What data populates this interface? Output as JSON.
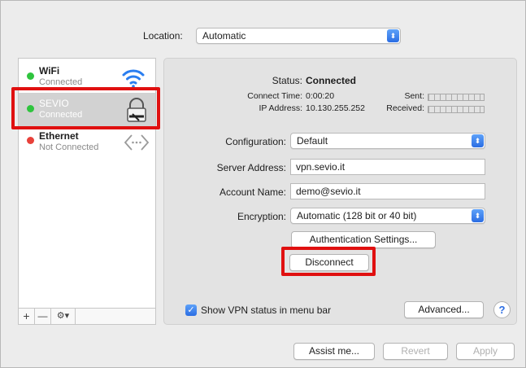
{
  "location": {
    "label": "Location:",
    "value": "Automatic"
  },
  "services": [
    {
      "name": "WiFi",
      "status": "Connected",
      "dot_color": "#2fc43e",
      "icon": "wifi-icon"
    },
    {
      "name": "SEVIO",
      "status": "Connected",
      "dot_color": "#2fc43e",
      "icon": "vpn-lock-icon",
      "selected": true
    },
    {
      "name": "Ethernet",
      "status": "Not Connected",
      "dot_color": "#e8413a",
      "icon": "ethernet-icon"
    }
  ],
  "sidebar_bar": {
    "add": "+",
    "remove": "—",
    "gear": "⚙▾"
  },
  "status": {
    "label": "Status:",
    "value": "Connected",
    "connect_time_label": "Connect Time:",
    "connect_time": "0:00:20",
    "ip_label": "IP Address:",
    "ip": "10.130.255.252",
    "sent_label": "Sent:",
    "received_label": "Received:"
  },
  "form": {
    "configuration_label": "Configuration:",
    "configuration_value": "Default",
    "server_label": "Server Address:",
    "server_value": "vpn.sevio.it",
    "account_label": "Account Name:",
    "account_value": "demo@sevio.it",
    "encryption_label": "Encryption:",
    "encryption_value": "Automatic (128 bit or 40 bit)"
  },
  "buttons": {
    "auth_settings": "Authentication Settings...",
    "disconnect": "Disconnect",
    "advanced": "Advanced...",
    "help": "?",
    "assist": "Assist me...",
    "revert": "Revert",
    "apply": "Apply"
  },
  "show_vpn_status": {
    "label": "Show VPN status in menu bar",
    "checked": true
  },
  "highlight_color": "#e01010"
}
